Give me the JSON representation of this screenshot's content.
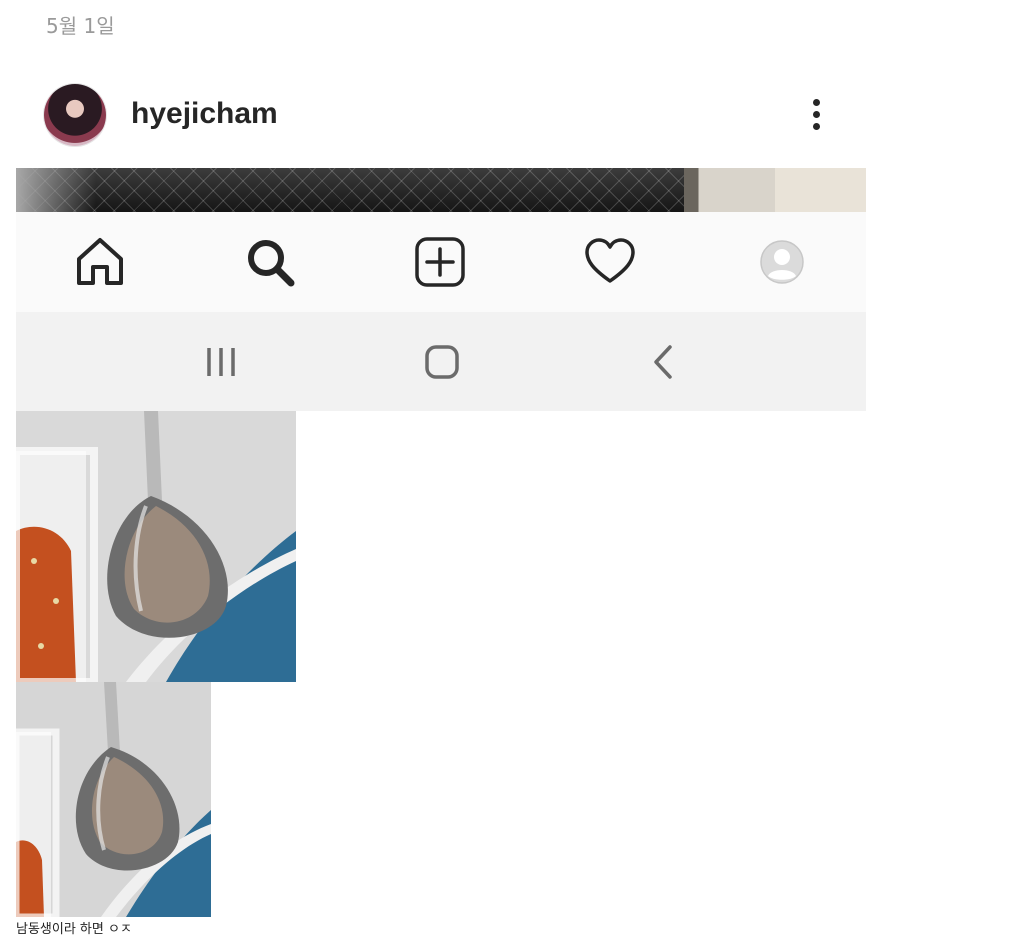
{
  "post": {
    "date": "5월 1일",
    "username": "hyejicham"
  },
  "icons": {
    "more": "more-vertical-icon",
    "home": "home-icon",
    "search": "search-icon",
    "add": "add-post-icon",
    "activity": "heart-icon",
    "profile": "profile-avatar-icon",
    "recents": "recents-icon",
    "system_home": "system-home-icon",
    "back": "back-icon"
  },
  "caption": "남동생이라 하면 ㅇㅈ"
}
